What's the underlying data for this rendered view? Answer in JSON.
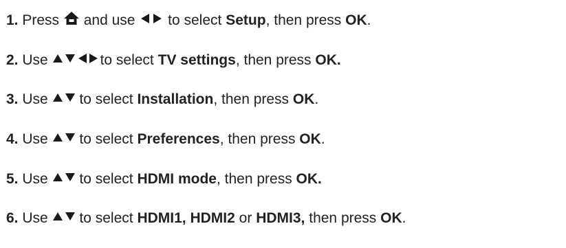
{
  "colors": {
    "text": "#222222",
    "icon": "#1a1a1a",
    "background": "#ffffff"
  },
  "steps": [
    {
      "number": "1.",
      "parts": [
        "Press",
        "and use",
        "to select",
        "Setup",
        ", then press",
        "OK",
        "."
      ],
      "icons": [
        "home-icon",
        "left-right-arrows-icon"
      ]
    },
    {
      "number": "2.",
      "parts": [
        "Use",
        "to select",
        "TV settings",
        ", then press",
        "OK."
      ],
      "icons": [
        "up-down-left-right-arrows-icon"
      ]
    },
    {
      "number": "3.",
      "parts": [
        "Use",
        "to select",
        "Installation",
        ", then press",
        "OK",
        "."
      ],
      "icons": [
        "up-down-arrows-icon"
      ]
    },
    {
      "number": "4.",
      "parts": [
        "Use",
        "to select",
        "Preferences",
        ", then press",
        "OK",
        "."
      ],
      "icons": [
        "up-down-arrows-icon"
      ]
    },
    {
      "number": "5.",
      "parts": [
        "Use",
        "to select",
        "HDMI mode",
        ", then press",
        "OK."
      ],
      "icons": [
        "up-down-arrows-icon"
      ]
    },
    {
      "number": "6.",
      "parts": [
        "Use",
        "to select",
        "HDMI1, HDMI2",
        "or",
        "HDMI3,",
        "then press",
        "OK",
        "."
      ],
      "icons": [
        "up-down-arrows-icon"
      ]
    }
  ]
}
